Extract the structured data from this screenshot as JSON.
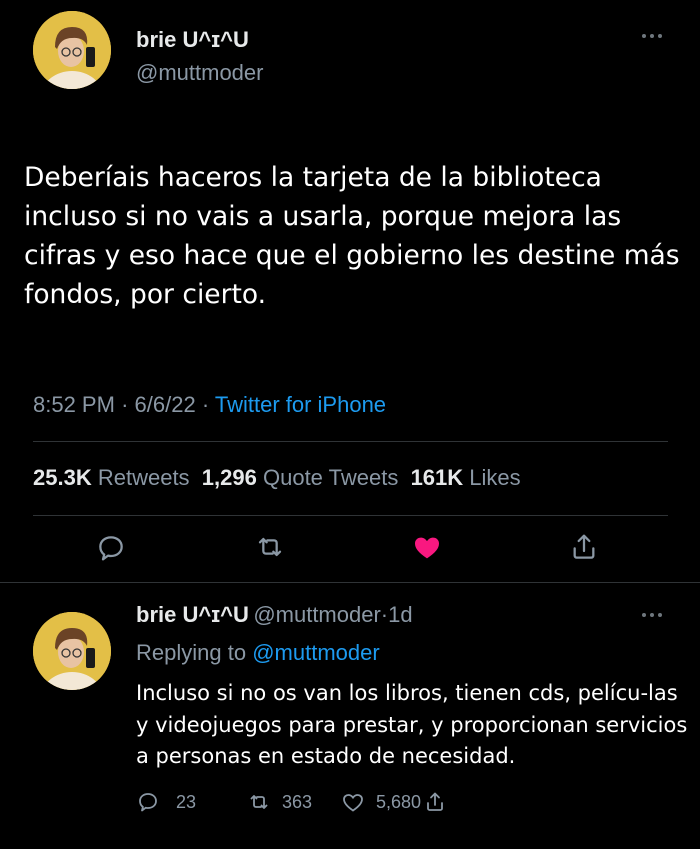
{
  "tweet": {
    "author_name": "brie U^ɪ^U",
    "author_handle": "@muttmoder",
    "text": "Deberíais haceros la tarjeta de la biblioteca incluso si no vais a usarla, porque mejora las cifras y eso hace que el gobierno les destine más fondos, por cierto.",
    "time": "8:52 PM",
    "sep1": "·",
    "date": "6/6/22",
    "sep2": "·",
    "source": "Twitter for iPhone",
    "retweets_count": "25.3K",
    "retweets_label": "Retweets",
    "quotes_count": "1,296",
    "quotes_label": "Quote Tweets",
    "likes_count": "161K",
    "likes_label": "Likes",
    "liked_color": "#f91880"
  },
  "reply": {
    "author_name": "brie U^ɪ^U",
    "author_handle": "@muttmoder",
    "sep": "·",
    "age": "1d",
    "replying_prefix": "Replying to",
    "replying_to": "@muttmoder",
    "text": "Incluso si no os van los libros, tienen cds, pelícu-las y videojuegos para prestar, y proporcionan servicios a personas en estado de necesidad.",
    "replies": "23",
    "retweets": "363",
    "likes": "5,680"
  },
  "icons": {
    "reply": "reply-icon",
    "retweet": "retweet-icon",
    "like": "heart-icon",
    "share": "share-icon",
    "more": "more-icon"
  },
  "colors": {
    "accent": "#1d9bf0",
    "background": "#000000"
  }
}
